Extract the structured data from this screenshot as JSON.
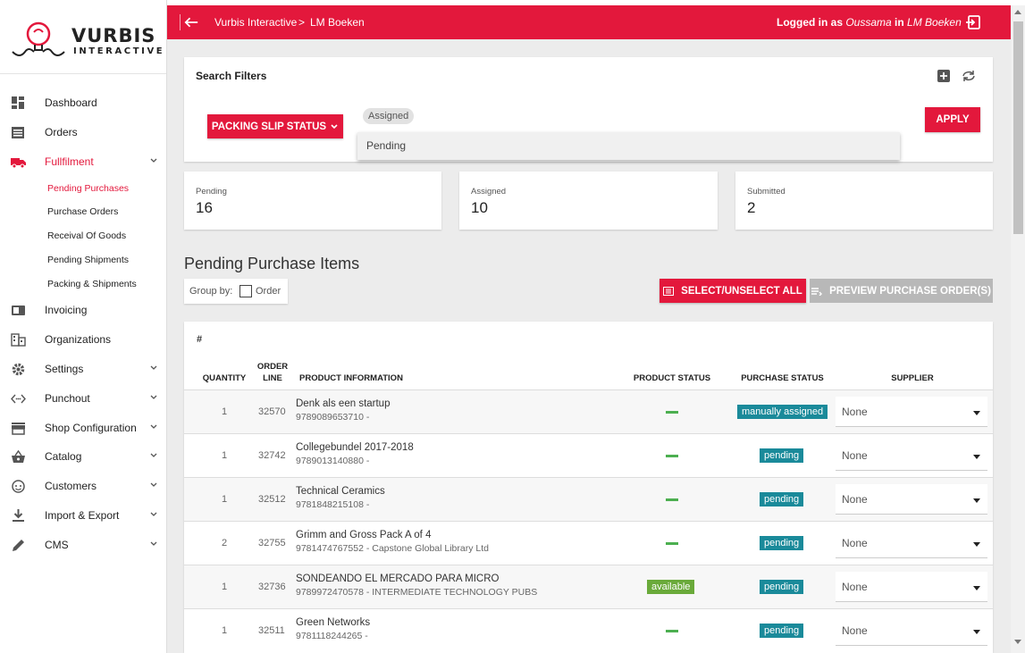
{
  "app": {
    "logo_word": "VURBIS",
    "logo_sub": "INTERACTIVE",
    "accent": "#e3183c"
  },
  "sidebar": {
    "items": [
      {
        "label": "Dashboard",
        "icon": "dashboard-icon"
      },
      {
        "label": "Orders",
        "icon": "orders-icon"
      },
      {
        "label": "Fullfilment",
        "icon": "truck-icon",
        "active": true
      },
      {
        "label": "Invoicing",
        "icon": "invoicing-icon"
      },
      {
        "label": "Organizations",
        "icon": "building-icon"
      },
      {
        "label": "Settings",
        "icon": "gear-icon"
      },
      {
        "label": "Punchout",
        "icon": "code-icon"
      },
      {
        "label": "Shop Configuration",
        "icon": "store-icon"
      },
      {
        "label": "Catalog",
        "icon": "basket-icon"
      },
      {
        "label": "Customers",
        "icon": "face-icon"
      },
      {
        "label": "Import & Export",
        "icon": "download-icon"
      },
      {
        "label": "CMS",
        "icon": "pencil-icon"
      }
    ],
    "subitems": [
      {
        "label": "Pending Purchases",
        "active": true
      },
      {
        "label": "Purchase Orders"
      },
      {
        "label": "Receival Of Goods"
      },
      {
        "label": "Pending Shipments"
      },
      {
        "label": "Packing & Shipments"
      }
    ]
  },
  "topbar": {
    "crumb1": "Vurbis Interactive",
    "separator": ">",
    "crumb2": "LM Boeken",
    "logged_prefix": "Logged in as ",
    "user": "Oussama",
    "logged_mid": " in ",
    "org": "LM Boeken"
  },
  "filters": {
    "title": "Search Filters",
    "button": "PACKING SLIP STATUS",
    "chip": "Assigned",
    "dropdown_option": "Pending",
    "apply": "APPLY"
  },
  "stats": [
    {
      "label": "Pending",
      "value": "16"
    },
    {
      "label": "Assigned",
      "value": "10"
    },
    {
      "label": "Submitted",
      "value": "2"
    }
  ],
  "section": {
    "title": "Pending Purchase Items",
    "group_by": "Group by:",
    "group_option": "Order",
    "select_all": "SELECT/UNSELECT ALL",
    "preview": "PREVIEW PURCHASE ORDER(S)"
  },
  "table": {
    "hash": "#",
    "headers": {
      "quantity": "QUANTITY",
      "order_line_1": "ORDER",
      "order_line_2": "LINE",
      "product": "PRODUCT INFORMATION",
      "product_status": "PRODUCT STATUS",
      "purchase_status": "PURCHASE STATUS",
      "supplier": "SUPPLIER"
    },
    "rows": [
      {
        "qty": "1",
        "line": "32570",
        "name": "Denk als een startup",
        "sub": "9789089653710 -",
        "product_status": "",
        "purchase_status": "manually assigned",
        "supplier": "None"
      },
      {
        "qty": "1",
        "line": "32742",
        "name": "Collegebundel 2017-2018",
        "sub": "9789013140880 -",
        "product_status": "",
        "purchase_status": "pending",
        "supplier": "None"
      },
      {
        "qty": "1",
        "line": "32512",
        "name": "Technical Ceramics",
        "sub": "9781848215108 -",
        "product_status": "",
        "purchase_status": "pending",
        "supplier": "None"
      },
      {
        "qty": "2",
        "line": "32755",
        "name": "Grimm and Gross Pack A of 4",
        "sub": "9781474767552 - Capstone Global Library Ltd",
        "product_status": "",
        "purchase_status": "pending",
        "supplier": "None"
      },
      {
        "qty": "1",
        "line": "32736",
        "name": "SONDEANDO EL MERCADO PARA MICRO",
        "sub": "9789972470578 - INTERMEDIATE TECHNOLOGY PUBS",
        "product_status": "available",
        "purchase_status": "pending",
        "supplier": "None"
      },
      {
        "qty": "1",
        "line": "32511",
        "name": "Green Networks",
        "sub": "9781118244265 -",
        "product_status": "",
        "purchase_status": "pending",
        "supplier": "None"
      }
    ]
  },
  "colors": {
    "pending_badge": "#1a8a9a",
    "available_badge": "#6aaa3a",
    "dash": "#4caf50"
  }
}
